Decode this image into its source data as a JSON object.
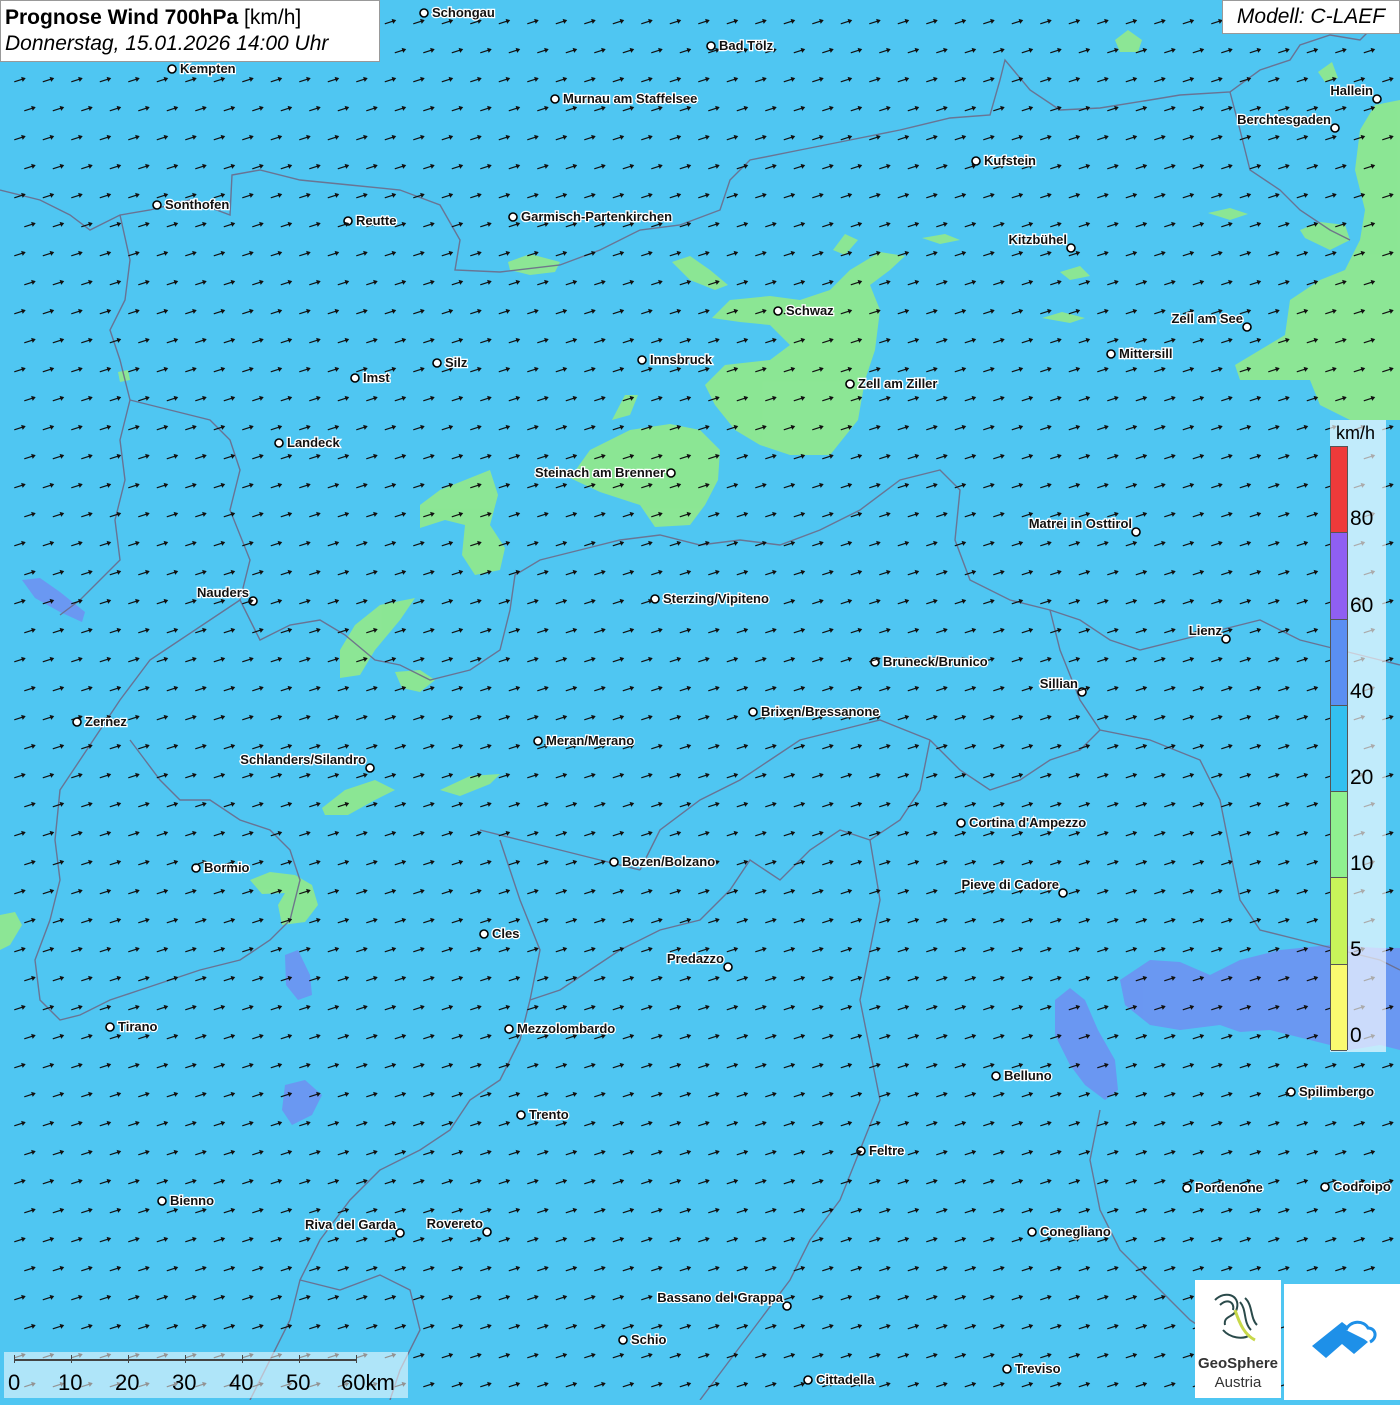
{
  "header": {
    "title_bold": "Prognose Wind 700hPa",
    "title_unit": "[km/h]",
    "datetime": "Donnerstag, 15.01.2026 14:00 Uhr",
    "model": "Modell: C-LAEF"
  },
  "legend": {
    "unit": "km/h",
    "labels": [
      "80",
      "60",
      "40",
      "20",
      "10",
      "5",
      "0"
    ],
    "colors": [
      "#ee3a3a",
      "#8f5ff2",
      "#5a8ff2",
      "#33c0ef",
      "#8ff08f",
      "#c8f45a",
      "#fafa70"
    ]
  },
  "scalebar": {
    "labels": [
      "0",
      "10",
      "20",
      "30",
      "40",
      "50",
      "60km"
    ]
  },
  "logo": {
    "line1": "GeoSphere",
    "line2": "Austria"
  },
  "colors": {
    "background": "#4fc6f2",
    "wind_10_20": "#8fe88f",
    "wind_0_10": "#6f8ff2",
    "borders": "#6b6b8a",
    "arrow": "#111111"
  },
  "cities": [
    {
      "name": "Schongau"
    },
    {
      "name": "Bad Tölz"
    },
    {
      "name": "Kempten"
    },
    {
      "name": "Murnau am Staffelsee"
    },
    {
      "name": "Hallein"
    },
    {
      "name": "Berchtesgaden"
    },
    {
      "name": "Kufstein"
    },
    {
      "name": "Sonthofen"
    },
    {
      "name": "Reutte"
    },
    {
      "name": "Garmisch-Partenkirchen"
    },
    {
      "name": "Kitzbühel"
    },
    {
      "name": "Schwaz"
    },
    {
      "name": "Zell am See"
    },
    {
      "name": "Innsbruck"
    },
    {
      "name": "Silz"
    },
    {
      "name": "Imst"
    },
    {
      "name": "Mittersill"
    },
    {
      "name": "Zell am Ziller"
    },
    {
      "name": "Landeck"
    },
    {
      "name": "Steinach am Brenner"
    },
    {
      "name": "Matrei in Osttirol"
    },
    {
      "name": "Nauders"
    },
    {
      "name": "Sterzing/Vipiteno"
    },
    {
      "name": "Lienz"
    },
    {
      "name": "Bruneck/Brunico"
    },
    {
      "name": "Sillian"
    },
    {
      "name": "Brixen/Bressanone"
    },
    {
      "name": "Zernez"
    },
    {
      "name": "Meran/Merano"
    },
    {
      "name": "Schlanders/Silandro"
    },
    {
      "name": "Cortina d'Ampezzo"
    },
    {
      "name": "Bozen/Bolzano"
    },
    {
      "name": "Bormio"
    },
    {
      "name": "Pieve di Cadore"
    },
    {
      "name": "Cles"
    },
    {
      "name": "Predazzo"
    },
    {
      "name": "Tirano"
    },
    {
      "name": "Mezzolombardo"
    },
    {
      "name": "Belluno"
    },
    {
      "name": "Spilimbergo"
    },
    {
      "name": "Trento"
    },
    {
      "name": "Feltre"
    },
    {
      "name": "Pordenone"
    },
    {
      "name": "Codroipo"
    },
    {
      "name": "Bienno"
    },
    {
      "name": "Riva del Garda"
    },
    {
      "name": "Rovereto"
    },
    {
      "name": "Conegliano"
    },
    {
      "name": "Bassano del Grappa"
    },
    {
      "name": "Schio"
    },
    {
      "name": "Treviso"
    },
    {
      "name": "Cittadella"
    }
  ]
}
